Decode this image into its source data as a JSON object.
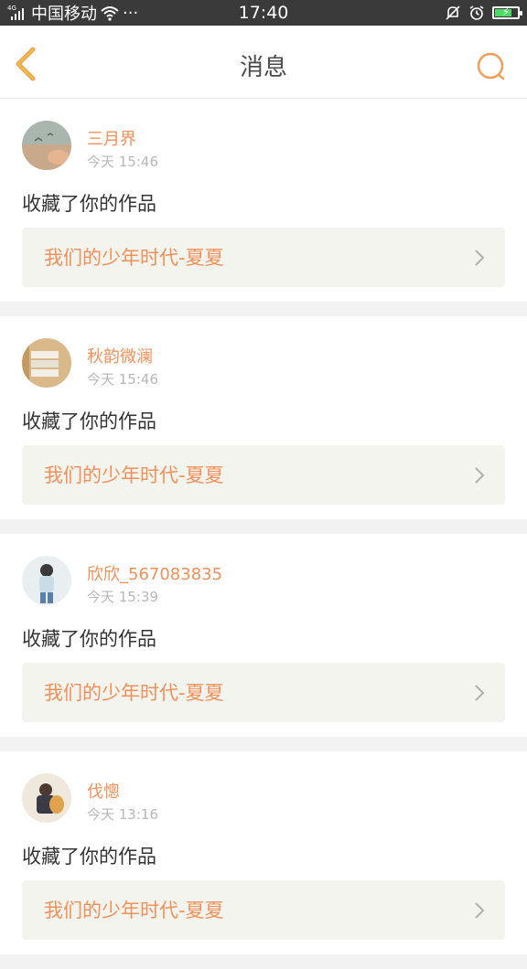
{
  "status_bar": {
    "network_type": "4G",
    "carrier": "中国移动",
    "more_indicator": "···",
    "time": "17:40",
    "battery_color": "#4cd964"
  },
  "header": {
    "title": "消息",
    "back_icon": "chevron-left-icon",
    "search_icon": "search-icon",
    "accent_color": "#f0a05a"
  },
  "messages": [
    {
      "username": "三月界",
      "time": "今天 15:46",
      "action": "收藏了你的作品",
      "work_title": "我们的少年时代-夏夏"
    },
    {
      "username": "秋韵微澜",
      "time": "今天 15:46",
      "action": "收藏了你的作品",
      "work_title": "我们的少年时代-夏夏"
    },
    {
      "username": "欣欣_567083835",
      "time": "今天 15:39",
      "action": "收藏了你的作品",
      "work_title": "我们的少年时代-夏夏"
    },
    {
      "username": "伐憁",
      "time": "今天 13:16",
      "action": "收藏了你的作品",
      "work_title": "我们的少年时代-夏夏"
    }
  ],
  "colors": {
    "username": "#f0905a",
    "link_background": "#f4f4ee"
  }
}
